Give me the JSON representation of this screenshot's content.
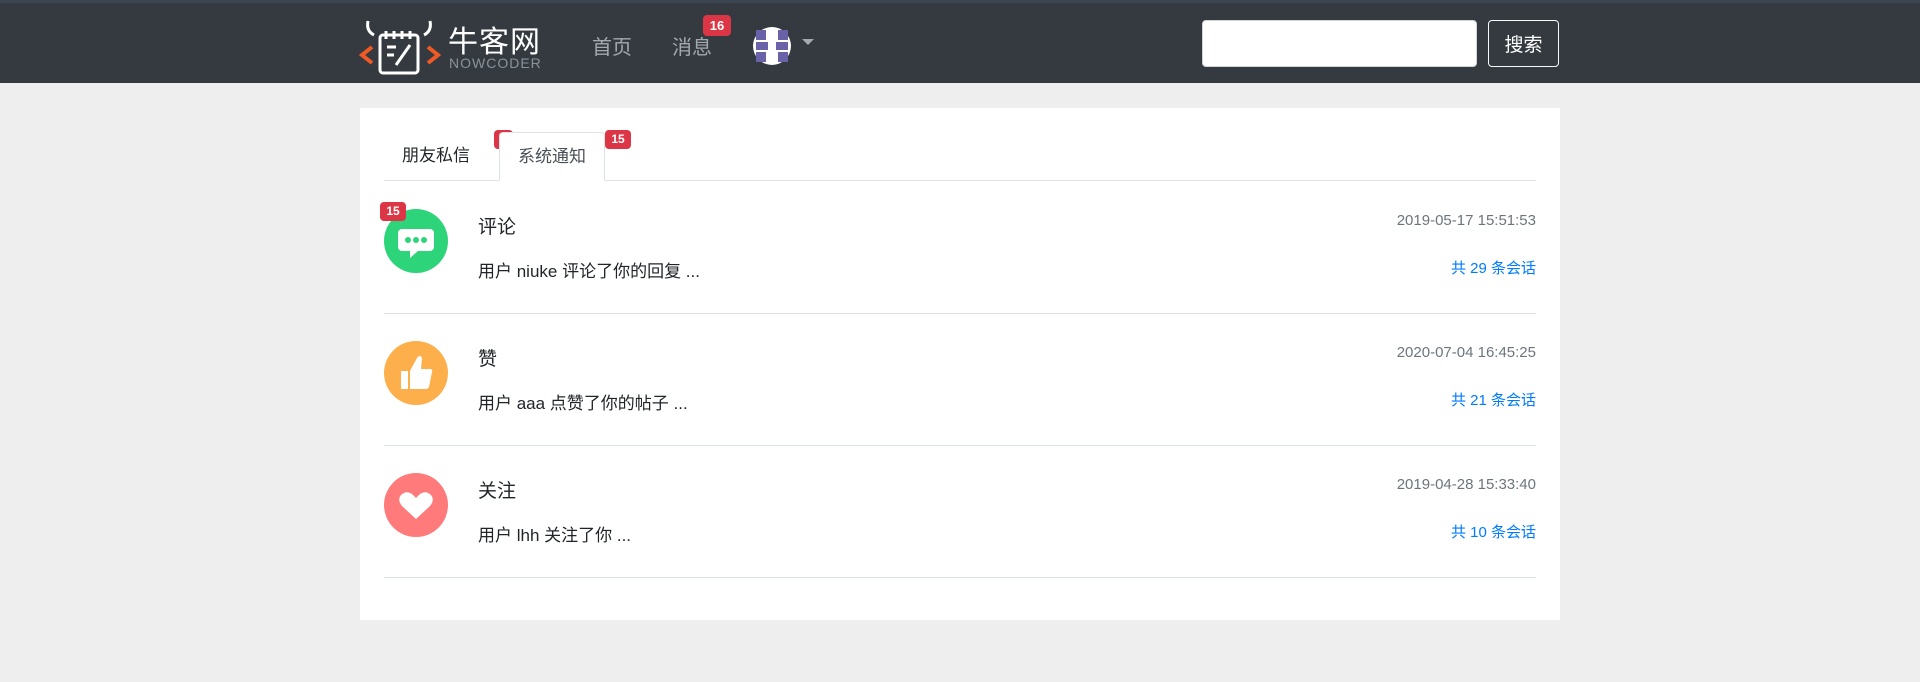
{
  "header": {
    "brand_cn": "牛客网",
    "brand_en": "NOWCODER",
    "nav": {
      "home": "首页",
      "messages": "消息",
      "messages_badge": "16"
    },
    "search": {
      "value": "",
      "placeholder": "",
      "button": "搜索"
    }
  },
  "tabs": {
    "friends": {
      "label": "朋友私信",
      "badge": "1"
    },
    "system": {
      "label": "系统通知",
      "badge": "15"
    }
  },
  "notices": [
    {
      "icon": "comment-icon",
      "color": "#2ed47a",
      "badge": "15",
      "title": "评论",
      "summary": "用户 niuke 评论了你的回复 ...",
      "time": "2019-05-17 15:51:53",
      "count": "共 29 条会话"
    },
    {
      "icon": "thumbs-up-icon",
      "color": "#fdaf4b",
      "badge": "",
      "title": "赞",
      "summary": "用户 aaa 点赞了你的帖子 ...",
      "time": "2020-07-04 16:45:25",
      "count": "共 21 条会话"
    },
    {
      "icon": "heart-icon",
      "color": "#ff7b7b",
      "badge": "",
      "title": "关注",
      "summary": "用户 lhh 关注了你 ...",
      "time": "2019-04-28 15:33:40",
      "count": "共 10 条会话"
    }
  ],
  "colors": {
    "header_bg": "#343a40",
    "page_bg": "#eeeeee",
    "badge": "#dc3545",
    "link": "#007bff"
  }
}
